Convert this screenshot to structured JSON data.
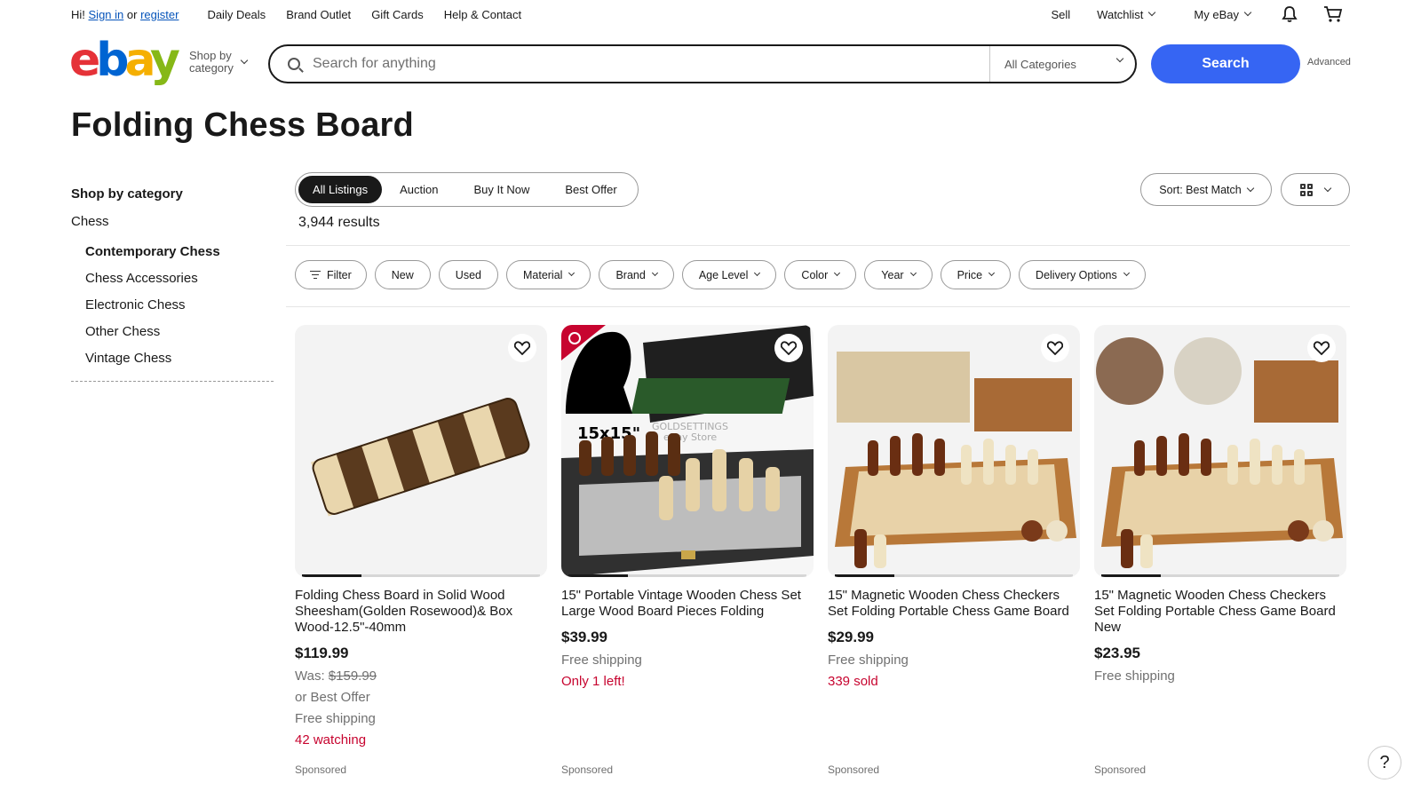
{
  "topbar": {
    "greeting_prefix": "Hi!",
    "sign_in": "Sign in",
    "or": "or",
    "register": "register",
    "links": [
      "Daily Deals",
      "Brand Outlet",
      "Gift Cards",
      "Help & Contact"
    ],
    "sell": "Sell",
    "watchlist": "Watchlist",
    "my_ebay": "My eBay"
  },
  "header": {
    "logo": "ebay",
    "shop_by_category": [
      "Shop by",
      "category"
    ],
    "search_placeholder": "Search for anything",
    "category_select": "All Categories",
    "search_button": "Search",
    "advanced": "Advanced"
  },
  "page_title": "Folding Chess Board",
  "sidebar": {
    "heading": "Shop by category",
    "top_category": "Chess",
    "items": [
      {
        "label": "Contemporary Chess",
        "active": true
      },
      {
        "label": "Chess Accessories",
        "active": false
      },
      {
        "label": "Electronic Chess",
        "active": false
      },
      {
        "label": "Other Chess",
        "active": false
      },
      {
        "label": "Vintage Chess",
        "active": false
      }
    ]
  },
  "listing_tabs": [
    "All Listings",
    "Auction",
    "Buy It Now",
    "Best Offer"
  ],
  "results_count": "3,944 results",
  "sort_label": "Sort: Best Match",
  "filters": [
    "Filter",
    "New",
    "Used",
    "Material",
    "Brand",
    "Age Level",
    "Color",
    "Year",
    "Price",
    "Delivery Options"
  ],
  "products": [
    {
      "title": "Folding Chess Board in Solid Wood Sheesham(Golden Rosewood)& Box Wood-12.5\"-40mm",
      "price": "$119.99",
      "was_label": "Was:",
      "was_price": "$159.99",
      "best_offer": "or Best Offer",
      "shipping": "Free shipping",
      "status": "42 watching",
      "sponsored": "Sponsored"
    },
    {
      "title": "15\" Portable Vintage Wooden Chess Set Large Wood Board Pieces Folding",
      "price": "$39.99",
      "shipping": "Free shipping",
      "status": "Only 1 left!",
      "sponsored": "Sponsored",
      "image_text": "15x15\"",
      "watermark": [
        "GOLDSETTINGS",
        "eBay Store"
      ]
    },
    {
      "title": "15\" Magnetic Wooden Chess Checkers Set Folding Portable Chess Game Board",
      "price": "$29.99",
      "shipping": "Free shipping",
      "status": "339 sold",
      "sponsored": "Sponsored"
    },
    {
      "title": "15\" Magnetic Wooden Chess Checkers Set Folding Portable Chess Game Board New",
      "price": "$23.95",
      "shipping": "Free shipping",
      "sponsored": "Sponsored"
    }
  ],
  "help": "?"
}
